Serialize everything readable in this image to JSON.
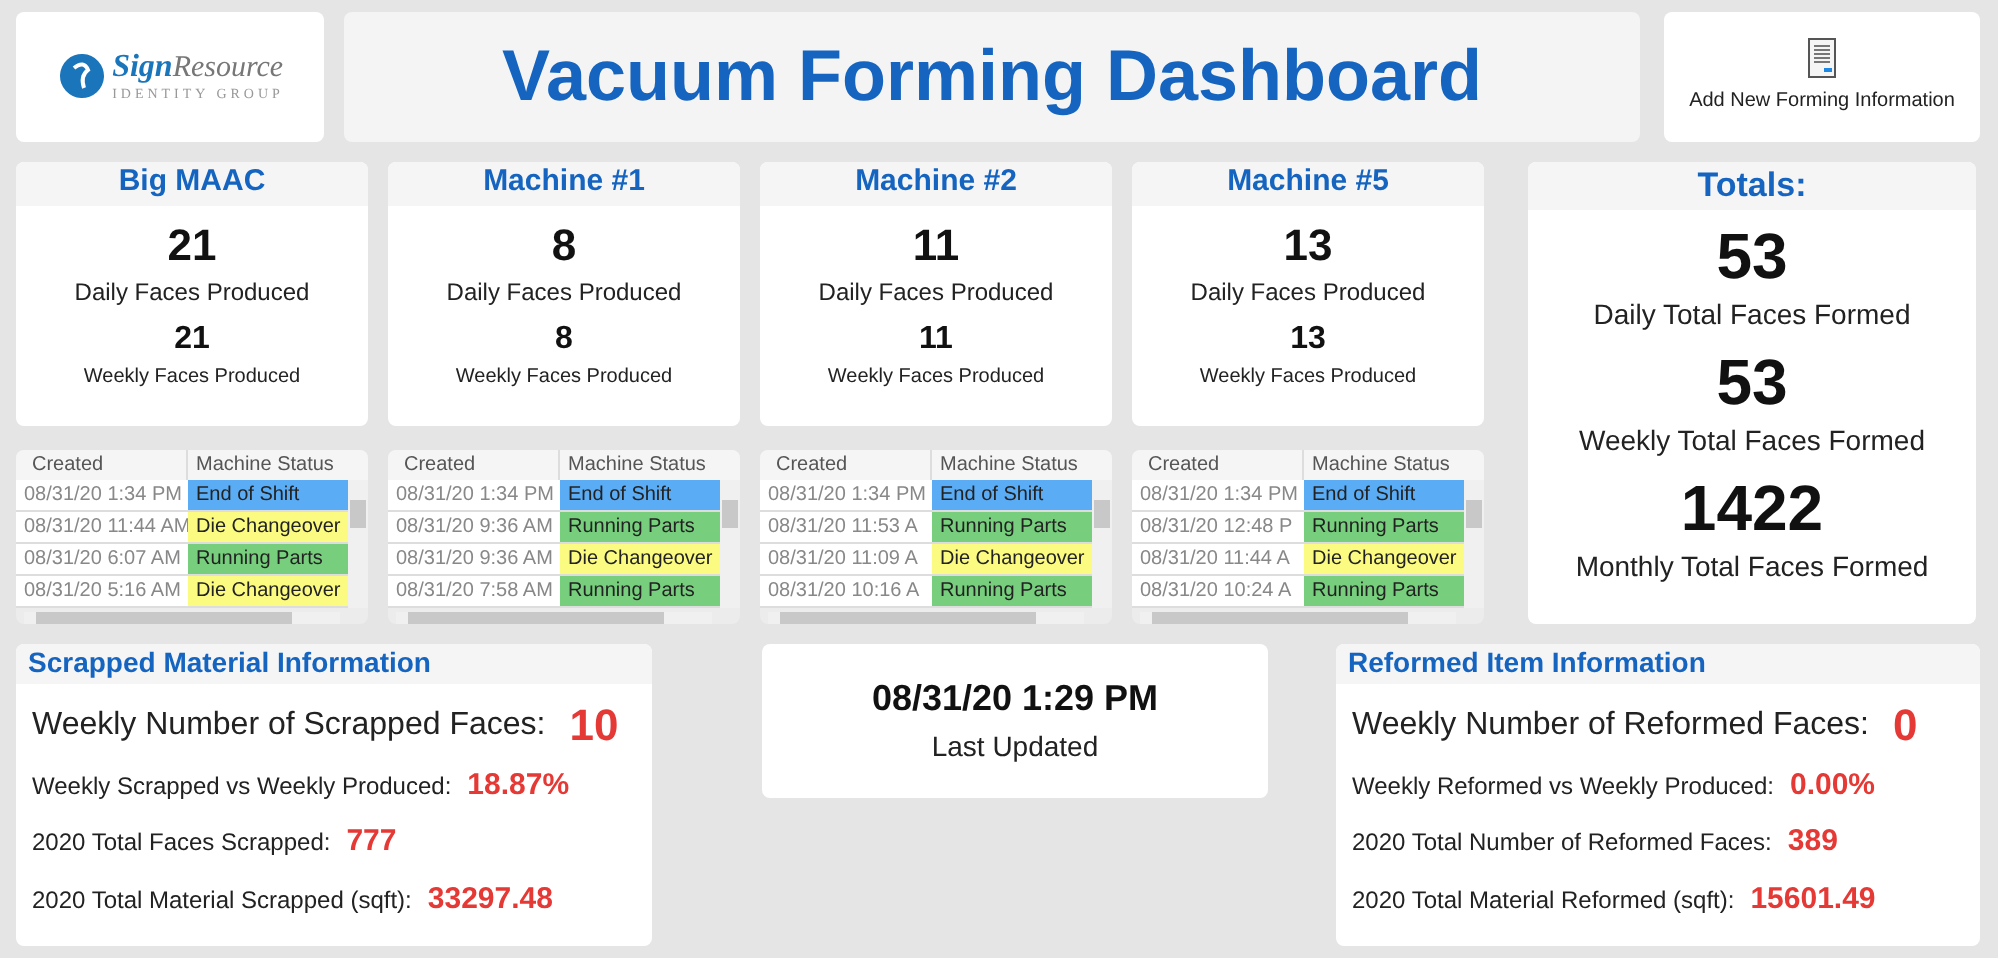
{
  "logo": {
    "mark": "Sign",
    "word": "Resource",
    "tagline": "IDENTITY GROUP"
  },
  "title": "Vacuum Forming Dashboard",
  "add_button": {
    "label": "Add New Forming Information"
  },
  "machines": [
    {
      "name": "Big MAAC",
      "daily": "21",
      "daily_label": "Daily Faces Produced",
      "weekly": "21",
      "weekly_label": "Weekly Faces Produced",
      "table": {
        "columns": [
          "Created",
          "Machine Status"
        ],
        "rows": [
          {
            "created": "08/31/20 1:34 PM",
            "status": "End of Shift",
            "color": "#5aacf5"
          },
          {
            "created": "08/31/20 11:44 AM",
            "status": "Die Changeover",
            "color": "#fbfb82"
          },
          {
            "created": "08/31/20 6:07 AM",
            "status": "Running Parts",
            "color": "#77cf7d"
          },
          {
            "created": "08/31/20 5:16 AM",
            "status": "Die Changeover",
            "color": "#fbfb82"
          }
        ]
      }
    },
    {
      "name": "Machine #1",
      "daily": "8",
      "daily_label": "Daily Faces Produced",
      "weekly": "8",
      "weekly_label": "Weekly Faces Produced",
      "table": {
        "columns": [
          "Created",
          "Machine Status"
        ],
        "rows": [
          {
            "created": "08/31/20 1:34 PM",
            "status": "End of Shift",
            "color": "#5aacf5"
          },
          {
            "created": "08/31/20 9:36 AM",
            "status": "Running Parts",
            "color": "#77cf7d"
          },
          {
            "created": "08/31/20 9:36 AM",
            "status": "Die Changeover",
            "color": "#fbfb82"
          },
          {
            "created": "08/31/20 7:58 AM",
            "status": "Running Parts",
            "color": "#77cf7d"
          }
        ]
      }
    },
    {
      "name": "Machine #2",
      "daily": "11",
      "daily_label": "Daily Faces Produced",
      "weekly": "11",
      "weekly_label": "Weekly Faces Produced",
      "table": {
        "columns": [
          "Created",
          "Machine Status"
        ],
        "rows": [
          {
            "created": "08/31/20 1:34 PM",
            "status": "End of Shift",
            "color": "#5aacf5"
          },
          {
            "created": "08/31/20 11:53 A",
            "status": "Running Parts",
            "color": "#77cf7d"
          },
          {
            "created": "08/31/20 11:09 A",
            "status": "Die Changeover",
            "color": "#fbfb82"
          },
          {
            "created": "08/31/20 10:16 A",
            "status": "Running Parts",
            "color": "#77cf7d"
          }
        ]
      }
    },
    {
      "name": "Machine #5",
      "daily": "13",
      "daily_label": "Daily Faces Produced",
      "weekly": "13",
      "weekly_label": "Weekly Faces Produced",
      "table": {
        "columns": [
          "Created",
          "Machine Status"
        ],
        "rows": [
          {
            "created": "08/31/20 1:34 PM",
            "status": "End of Shift",
            "color": "#5aacf5"
          },
          {
            "created": "08/31/20 12:48 P",
            "status": "Running Parts",
            "color": "#77cf7d"
          },
          {
            "created": "08/31/20 11:44 A",
            "status": "Die Changeover",
            "color": "#fbfb82"
          },
          {
            "created": "08/31/20 10:24 A",
            "status": "Running Parts",
            "color": "#77cf7d"
          }
        ]
      }
    }
  ],
  "totals": {
    "title": "Totals:",
    "items": [
      {
        "value": "53",
        "label": "Daily Total Faces Formed"
      },
      {
        "value": "53",
        "label": "Weekly Total Faces Formed"
      },
      {
        "value": "1422",
        "label": "Monthly Total Faces Formed"
      }
    ]
  },
  "scrapped": {
    "title": "Scrapped Material Information",
    "headline": {
      "label": "Weekly Number of Scrapped Faces:",
      "value": "10"
    },
    "items": [
      {
        "label": "Weekly Scrapped vs Weekly Produced:",
        "value": "18.87%"
      },
      {
        "label": "2020 Total Faces Scrapped:",
        "value": "777"
      },
      {
        "label": "2020 Total Material Scrapped (sqft):",
        "value": "33297.48"
      }
    ]
  },
  "updated": {
    "time": "08/31/20 1:29 PM",
    "label": "Last Updated"
  },
  "reformed": {
    "title": "Reformed Item Information",
    "headline": {
      "label": "Weekly Number of Reformed Faces:",
      "value": "0"
    },
    "items": [
      {
        "label": "Weekly Reformed vs Weekly Produced:",
        "value": "0.00%"
      },
      {
        "label": "2020 Total Number of Reformed Faces:",
        "value": "389"
      },
      {
        "label": "2020 Total Material Reformed (sqft):",
        "value": "15601.49"
      }
    ]
  }
}
